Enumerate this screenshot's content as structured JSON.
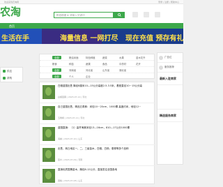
{
  "topbar": {
    "left": "欢迎来到农淘网",
    "right": "登录 | 注册 | 帮助中心"
  },
  "logo": "农淘",
  "search": {
    "dropdown": "供应信息 ▾",
    "placeholder": "请输入关键词"
  },
  "nav": {
    "home": "首页"
  },
  "banner": {
    "text1": "生活在手",
    "text2": "海量信息 一网打尽",
    "text3": "现在充值 预存有礼"
  },
  "sidebar": {
    "items": [
      "供应",
      "求购"
    ]
  },
  "filter": {
    "rows": [
      {
        "items": [
          "全部",
          "粮油米面",
          "特色种植",
          "蔬菜",
          "水果",
          "苗木花卉"
        ],
        "active": 0
      },
      {
        "items": [
          "粮食",
          "种苗",
          "蔬果",
          "食品",
          "中药材",
          "花卉"
        ],
        "active": -1
      },
      {
        "items": [
          "全部",
          "河南省",
          "河北省",
          "山东省",
          "湖北省"
        ],
        "active": 0
      },
      {
        "items": [
          "全部",
          "个人",
          "企业"
        ],
        "active": 0
      }
    ]
  },
  "list": [
    {
      "title": "白蜡苗圃出售 胸径8厘米10—15公分高度2.5-3.5米，基座直径10－15公分高",
      "meta": "白蜡苗圃 | 2023-07-12 | 河北"
    },
    {
      "title": "自己苗圃出售、精品五角枫：米径10－20cm，1000棵 高度约米，地径12~",
      "meta": "五角枫 | 2023-07-11 | 河北"
    },
    {
      "title": "苗圃直销：（1）高杆海棠米径13—16cm，810—17公分1000棵",
      "meta": "海棠 | 2023-07-10 | 山东"
    },
    {
      "title": "出售，商丘地区一、二、三级苗木，白蜡、白杨、垂柳等多个品种",
      "meta": "苗木 | 2023-07-09 | 河南"
    },
    {
      "title": "直销优质国槐苗木，胸径8-12公分，直接发往全国各地",
      "meta": "国槐 | 2023-07-08 | 山东"
    }
  ],
  "right": {
    "ad_label": "广告位",
    "promo_label": "服务推荐",
    "recent_title": "最新入驻商家",
    "quality_title": "精选服务商家"
  }
}
